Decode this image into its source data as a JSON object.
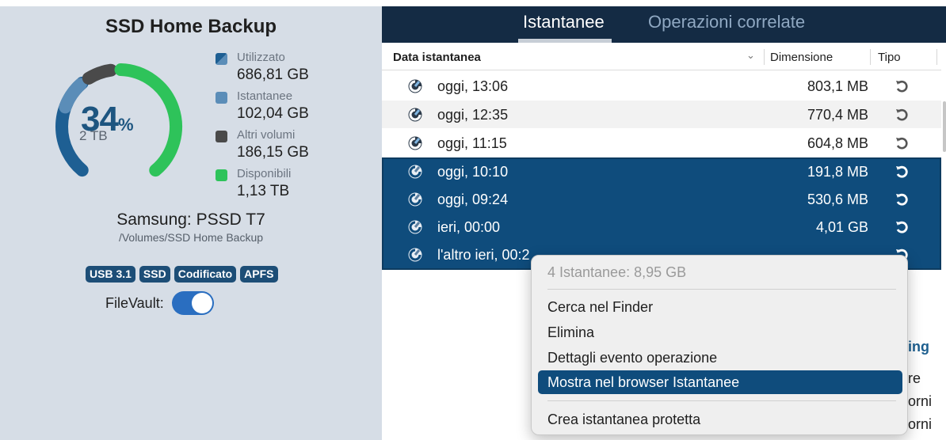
{
  "disk": {
    "title": "SSD Home Backup",
    "percent_used": "34",
    "percent_sign": "%",
    "capacity": "2 TB",
    "model": "Samsung: PSSD T7",
    "path": "/Volumes/SSD Home Backup",
    "badges": [
      "USB 3.1",
      "SSD",
      "Codificato",
      "APFS"
    ],
    "filevault_label": "FileVault:",
    "filevault_on": true,
    "legend": [
      {
        "name": "Utilizzato",
        "value": "686,81 GB",
        "color": "#1e5f93"
      },
      {
        "name": "Istantanee",
        "value": "102,04 GB",
        "color": "#5b8db8"
      },
      {
        "name": "Altri volumi",
        "value": "186,15 GB",
        "color": "#4a4a4a"
      },
      {
        "name": "Disponibili",
        "value": "1,13 TB",
        "color": "#2ec35a"
      }
    ]
  },
  "tabs": [
    {
      "label": "Istantanee",
      "active": true
    },
    {
      "label": "Operazioni correlate",
      "active": false
    }
  ],
  "table": {
    "columns": {
      "date": "Data istantanea",
      "size": "Dimensione",
      "type": "Tipo"
    },
    "rows": [
      {
        "date": "oggi, 13:06",
        "size": "803,1 MB",
        "selected": false
      },
      {
        "date": "oggi, 12:35",
        "size": "770,4 MB",
        "selected": false
      },
      {
        "date": "oggi, 11:15",
        "size": "604,8 MB",
        "selected": false
      },
      {
        "date": "oggi, 10:10",
        "size": "191,8 MB",
        "selected": true
      },
      {
        "date": "oggi, 09:24",
        "size": "530,6 MB",
        "selected": true
      },
      {
        "date": "ieri, 00:00",
        "size": "4,01 GB",
        "selected": true
      },
      {
        "date": "l'altro ieri, 00:2",
        "size": "",
        "selected": true
      }
    ]
  },
  "background_fragments": {
    "heading_fragment": "ing",
    "line1": "re",
    "line2": "orni",
    "line3": "orni"
  },
  "context_menu": {
    "header": "4 Istantanee: 8,95 GB",
    "items": [
      "Cerca nel Finder",
      "Elimina",
      "Dettagli evento operazione",
      "Mostra nel browser Istantanee"
    ],
    "highlighted_index": 3,
    "footer_item": "Crea istantanea protetta"
  },
  "colors": {
    "accent": "#0f4c7c",
    "tabbar": "#142b44",
    "left_panel_bg": "#d6dde6"
  }
}
